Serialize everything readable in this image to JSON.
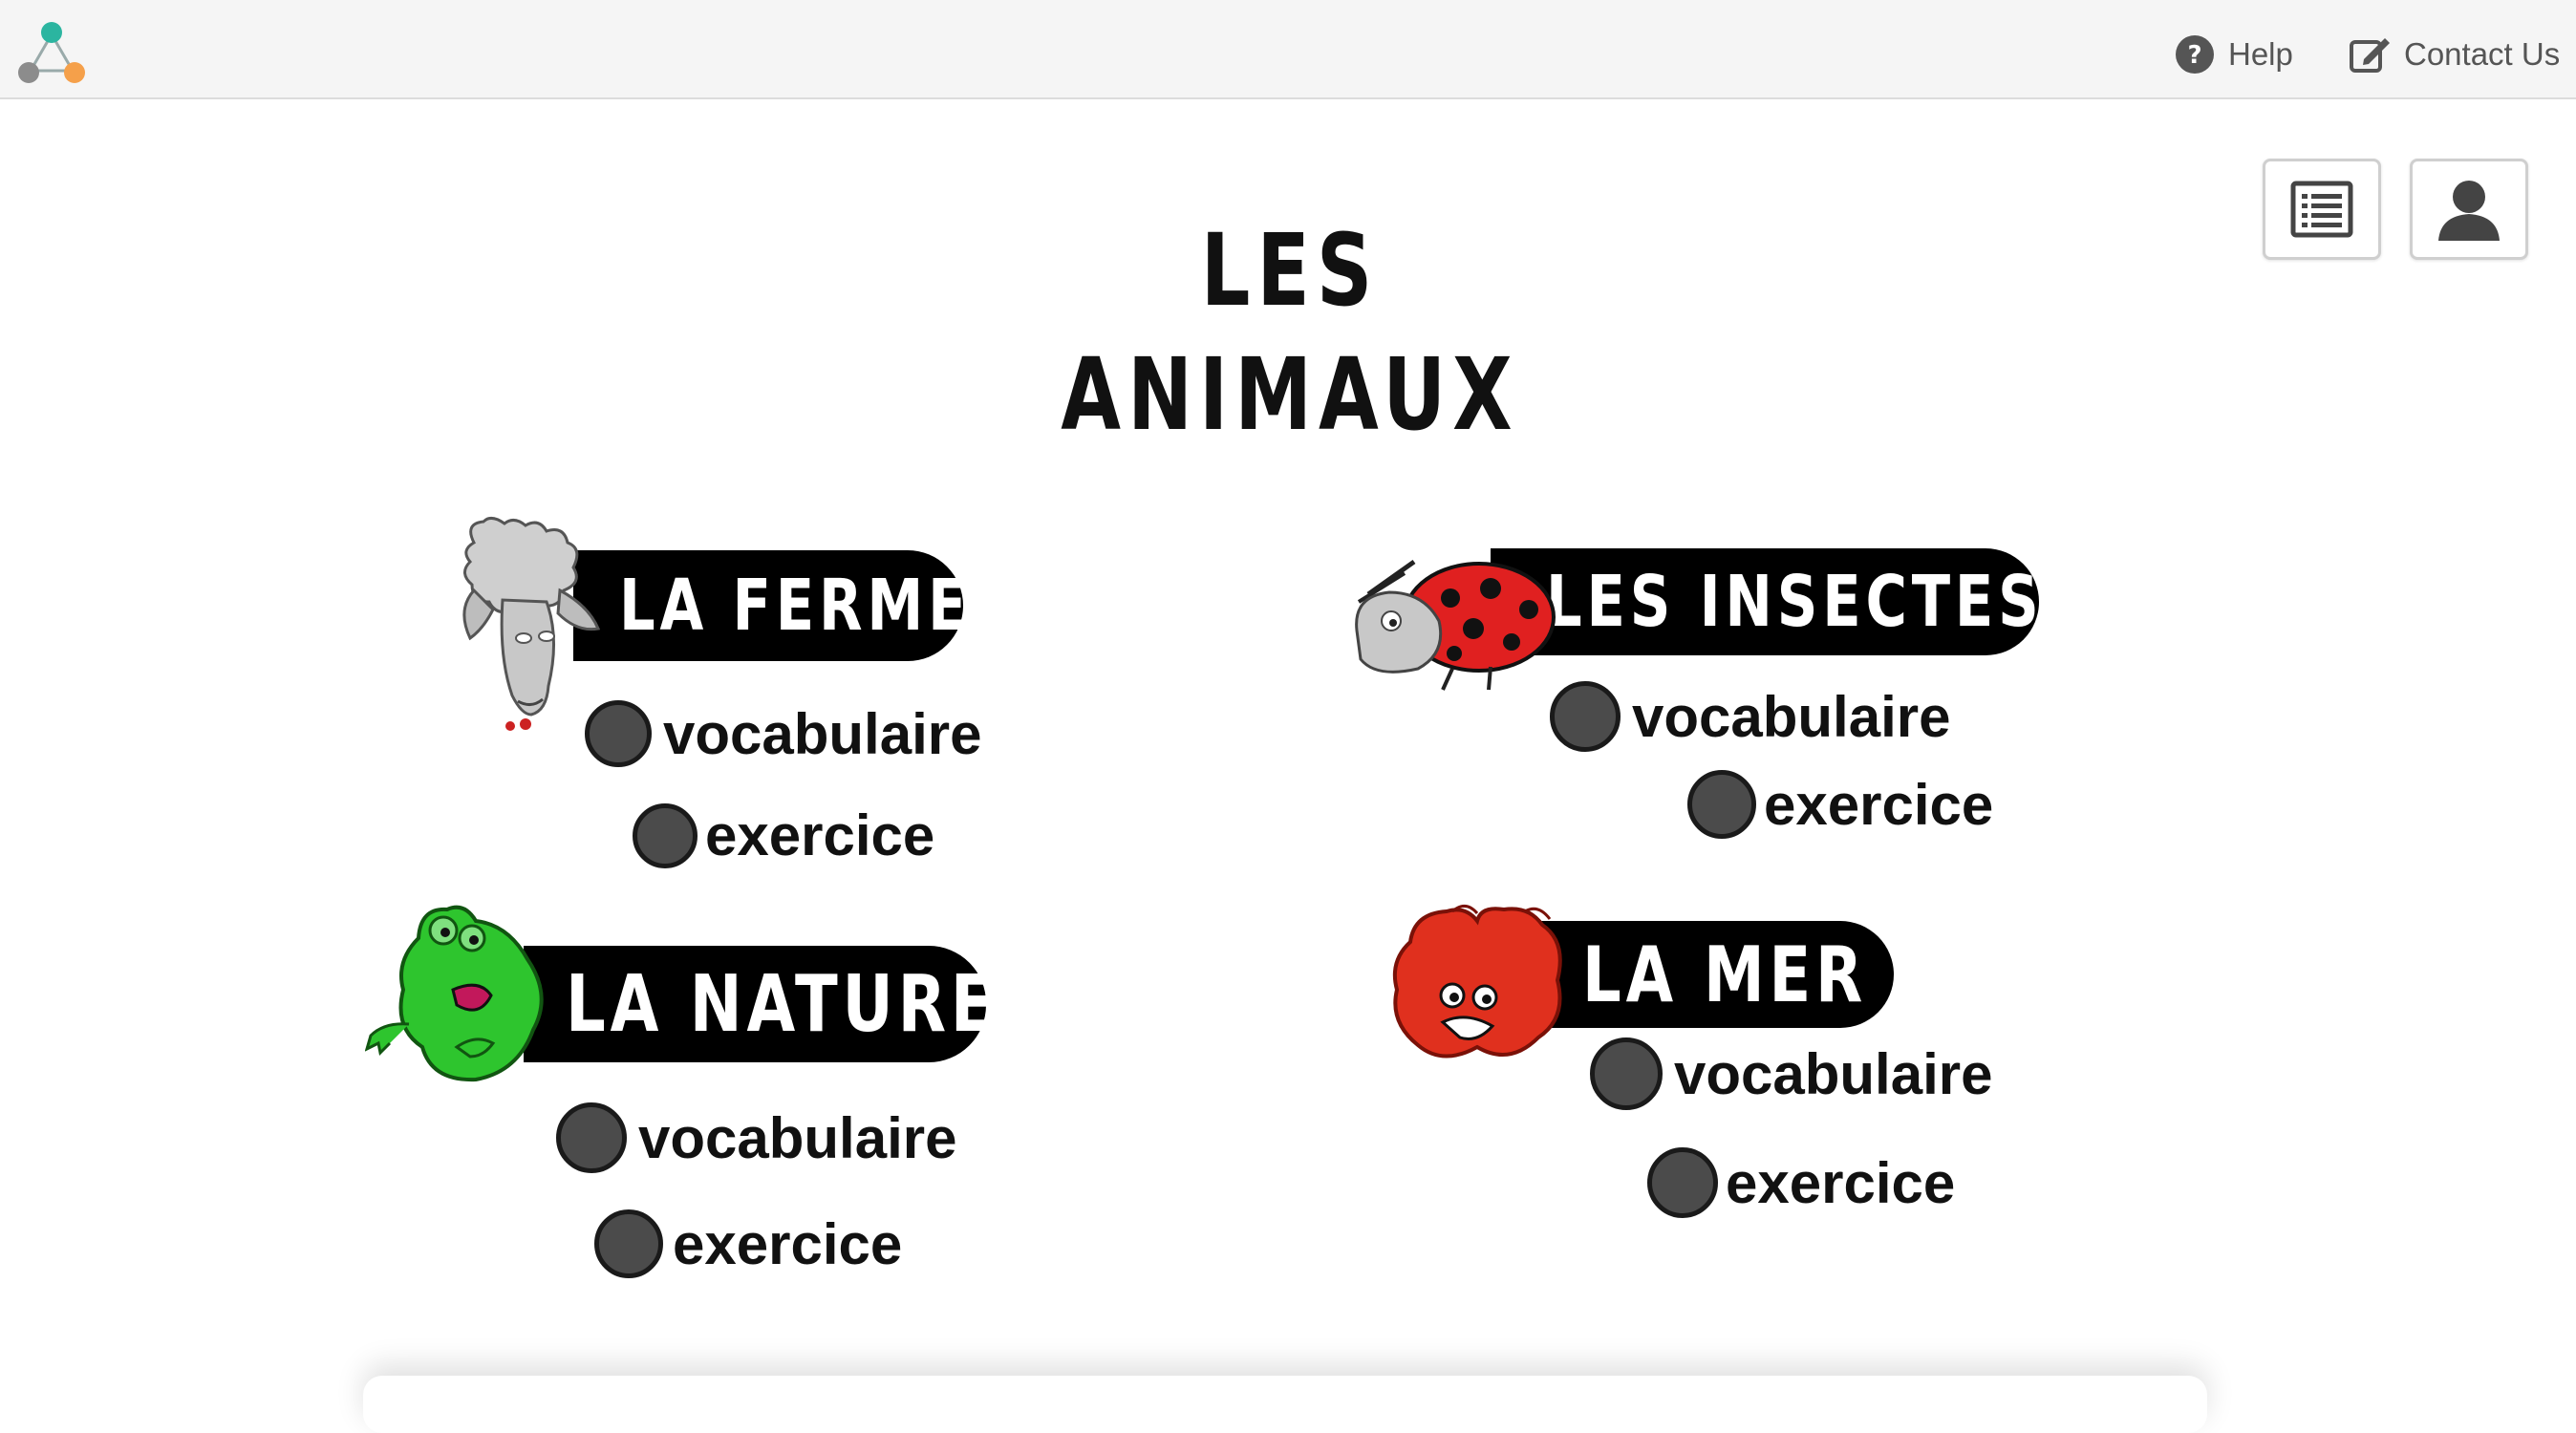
{
  "topbar": {
    "help_label": "Help",
    "contact_label": "Contact Us"
  },
  "page": {
    "title": "LES ANIMAUX"
  },
  "categories": [
    {
      "title": "LA FERME",
      "mascot": "sheep-icon",
      "color": "#bdbdbd",
      "vocab_label": "vocabulaire",
      "exercise_label": "exercice"
    },
    {
      "title": "LES INSECTES",
      "mascot": "ladybug-icon",
      "color": "#e02020",
      "vocab_label": "vocabulaire",
      "exercise_label": "exercice"
    },
    {
      "title": "LA NATURE",
      "mascot": "frog-icon",
      "color": "#2ec52e",
      "vocab_label": "vocabulaire",
      "exercise_label": "exercice"
    },
    {
      "title": "LA MER",
      "mascot": "crab-icon",
      "color": "#e0301e",
      "vocab_label": "vocabulaire",
      "exercise_label": "exercice"
    }
  ],
  "icons": {
    "logo": "app-logo-icon",
    "help": "question-circle-icon",
    "contact": "edit-icon",
    "list_button": "list-icon",
    "user_button": "user-icon"
  }
}
